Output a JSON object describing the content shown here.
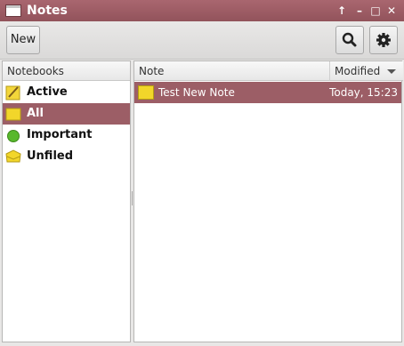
{
  "window": {
    "title": "Notes"
  },
  "titlebar": {
    "buttons": [
      "↑",
      "–",
      "□",
      "✕"
    ]
  },
  "toolbar": {
    "new_label": "New"
  },
  "notebooks": {
    "header": "Notebooks",
    "items": [
      {
        "label": "Active",
        "icon": "pencil-notebook-icon"
      },
      {
        "label": "All",
        "icon": "folder-icon"
      },
      {
        "label": "Important",
        "icon": "green-dot-icon"
      },
      {
        "label": "Unfiled",
        "icon": "open-folder-icon"
      }
    ],
    "selected": "All"
  },
  "notes": {
    "columns": {
      "note": "Note",
      "modified": "Modified"
    },
    "rows": [
      {
        "title": "Test New Note",
        "modified": "Today, 15:23"
      }
    ]
  },
  "colors": {
    "accent": "#9c5e66"
  }
}
